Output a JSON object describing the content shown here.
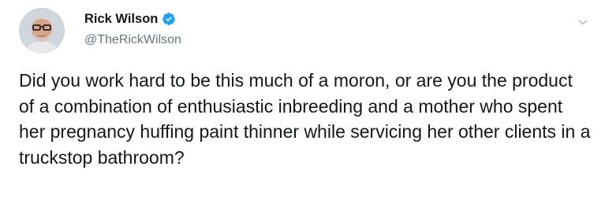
{
  "author": {
    "display_name": "Rick Wilson",
    "handle": "@TheRickWilson",
    "verified": true,
    "avatar_icon": "user-avatar-photo"
  },
  "tweet": {
    "text": "Did you work hard to be this much of a moron, or are you the product of a combination of enthusiastic inbreeding and a mother who spent her pregnancy huffing paint thinner while servicing her other clients in a truckstop bathroom?"
  },
  "icons": {
    "verified": "verified-badge-icon",
    "more": "chevron-down-icon"
  },
  "colors": {
    "text": "#14171a",
    "secondary_text": "#657786",
    "verified_blue": "#1da1f2",
    "chevron": "#aab8c2"
  }
}
